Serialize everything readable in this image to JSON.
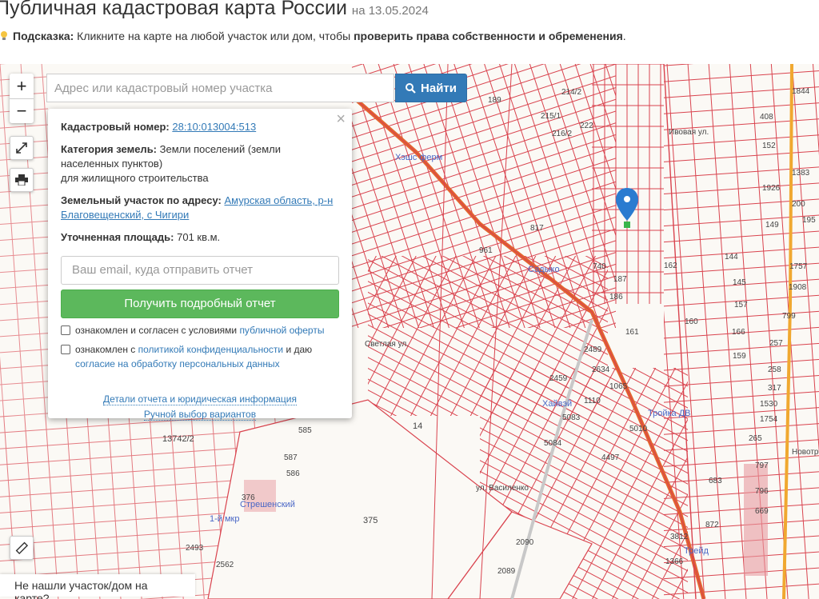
{
  "header": {
    "title": "Публичная кадастровая карта России",
    "date": "на 13.05.2024",
    "hint_label": "Подсказка:",
    "hint_text": " Кликните на карте на любой участок или дом, чтобы ",
    "hint_bold": "проверить права собственности и обременения",
    "hint_end": "."
  },
  "map": {
    "zoom_in": "+",
    "zoom_out": "−",
    "search_placeholder": "Адрес или кадастровый номер участка",
    "search_button": "Найти",
    "not_found": "Не нашли участок/дом на карте?",
    "labels": [
      "13742/2",
      "14",
      "375",
      "2090",
      "2089",
      "2562",
      "2493",
      "585",
      "587",
      "586",
      "376",
      "5084",
      "4497",
      "5083",
      "2459",
      "2489",
      "2634",
      "1065",
      "1110",
      "5010",
      "3812",
      "1366",
      "683",
      "872",
      "797",
      "796",
      "669",
      "265",
      "1754",
      "1530",
      "317",
      "258",
      "159",
      "257",
      "166",
      "160",
      "157",
      "145",
      "144",
      "162",
      "161",
      "186",
      "187",
      "740",
      "817",
      "961",
      "152",
      "1926",
      "200",
      "1383",
      "1844",
      "408",
      "1757",
      "799",
      "1908",
      "149",
      "195",
      "189",
      "222",
      "214/2",
      "216/2",
      "215/1",
      "ул. Василенко",
      "Новотроицкое ш.",
      "Светлая ул.",
      "Ивовая ул."
    ],
    "pois": [
      "Хэшс ферм",
      "Садыко",
      "Хайвэй",
      "Тройка ДВ",
      "Стрешенский",
      "1-й мкр",
      "Трейд"
    ]
  },
  "popup": {
    "close": "×",
    "cad_label": "Кадастровый номер:",
    "cad_value": "28:10:013004:513",
    "cat_label": "Категория земель:",
    "cat_value": "Земли поселений (земли населенных пунктов)",
    "cat_use": "для жилищного строительства",
    "addr_label": "Земельный участок по адресу:",
    "addr_value": "Амурская область, р-н Благовещенский, с Чигири",
    "area_label": "Уточненная площадь:",
    "area_value": "701 кв.м.",
    "email_placeholder": "Ваш email, куда отправить отчет",
    "report_button": "Получить подробный отчет",
    "chk1_text": "ознакомлен и согласен с условиями ",
    "chk1_link": "публичной оферты",
    "chk2_text": "ознакомлен с ",
    "chk2_link": "политикой конфиденциальности",
    "chk2_mid": " и даю ",
    "chk2_link2": "согласие на обработку персональных данных",
    "details_link": "Детали отчета и юридическая информация",
    "manual_link": "Ручной выбор вариантов"
  },
  "colors": {
    "parcel": "#d9434e",
    "road": "#e2662f",
    "accent": "#337ab7",
    "green": "#5cb85c"
  },
  "icons": [
    "lightbulb-icon",
    "expand-icon",
    "print-icon",
    "search-icon",
    "ruler-icon",
    "map-marker-icon"
  ]
}
